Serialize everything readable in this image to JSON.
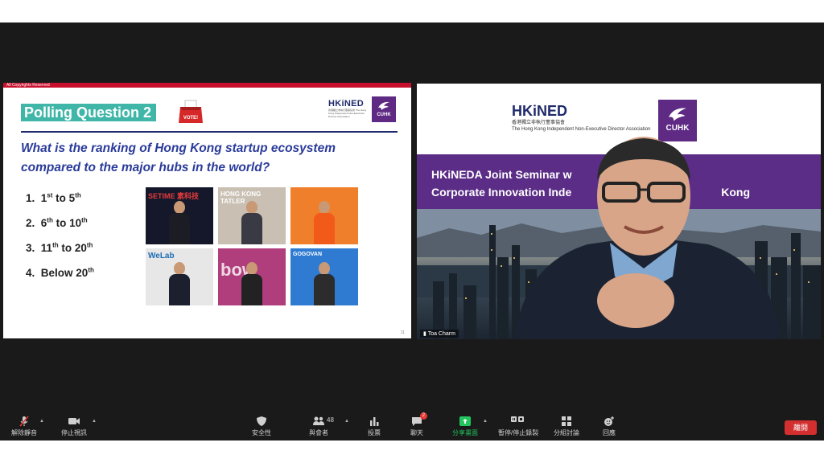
{
  "slide": {
    "copyright": "All Copyrights Reserved",
    "poll_title": "Polling Question 2",
    "vote_label": "VOTE!",
    "logo_text": "HKiNED",
    "logo_sub": "香港獨立非執行董事協會 The Hong Kong Independent Non-Executive Director Association",
    "cuhk_label": "CUHK",
    "question": "What is the ranking of Hong Kong startup ecosystem compared to the major hubs in the world?",
    "options": [
      {
        "num": "1.",
        "a": "1",
        "a_sup": "st",
        "mid": " to 5",
        "b_sup": "th"
      },
      {
        "num": "2.",
        "a": "6",
        "a_sup": "th",
        "mid": " to 10",
        "b_sup": "th"
      },
      {
        "num": "3.",
        "a": "11",
        "a_sup": "th",
        "mid": " to 20",
        "b_sup": "th"
      },
      {
        "num": "4.",
        "a": "Below 20",
        "a_sup": "th",
        "mid": "",
        "b_sup": ""
      }
    ],
    "photo_labels": [
      "SETIME 素科技",
      "HONG KONG TATLER",
      "",
      "WeLab",
      "bow",
      "GOGOVAN"
    ],
    "page_number": "11"
  },
  "video": {
    "logo_text": "HKiNED",
    "logo_sub": "香港獨立非執行董事協會",
    "logo_sub2": "The Hong Kong Independent Non-Executive Director Association",
    "cuhk_label": "CUHK",
    "seminar_line1": "HKiNEDA Joint Seminar w",
    "seminar_line2": "Corporate Innovation Inde",
    "seminar_line2_tail": "Kong",
    "speaker_name": "Toa Charm"
  },
  "toolbar": {
    "unmute": "解除靜音",
    "stop_video": "停止視訊",
    "security": "安全性",
    "participants": "與會者",
    "participants_count": "48",
    "polls": "投票",
    "chat": "聊天",
    "chat_badge": "2",
    "share_screen": "分享畫面",
    "pause_recording": "暫停/停止錄製",
    "breakout_rooms": "分組討論",
    "reactions": "回應",
    "leave": "離開"
  },
  "colors": {
    "poll_bg": "#3fb6a8",
    "question_text": "#2a3b9a",
    "brand_purple": "#5b2d86",
    "share_green": "#22c55e",
    "leave_red": "#d32f2f"
  }
}
